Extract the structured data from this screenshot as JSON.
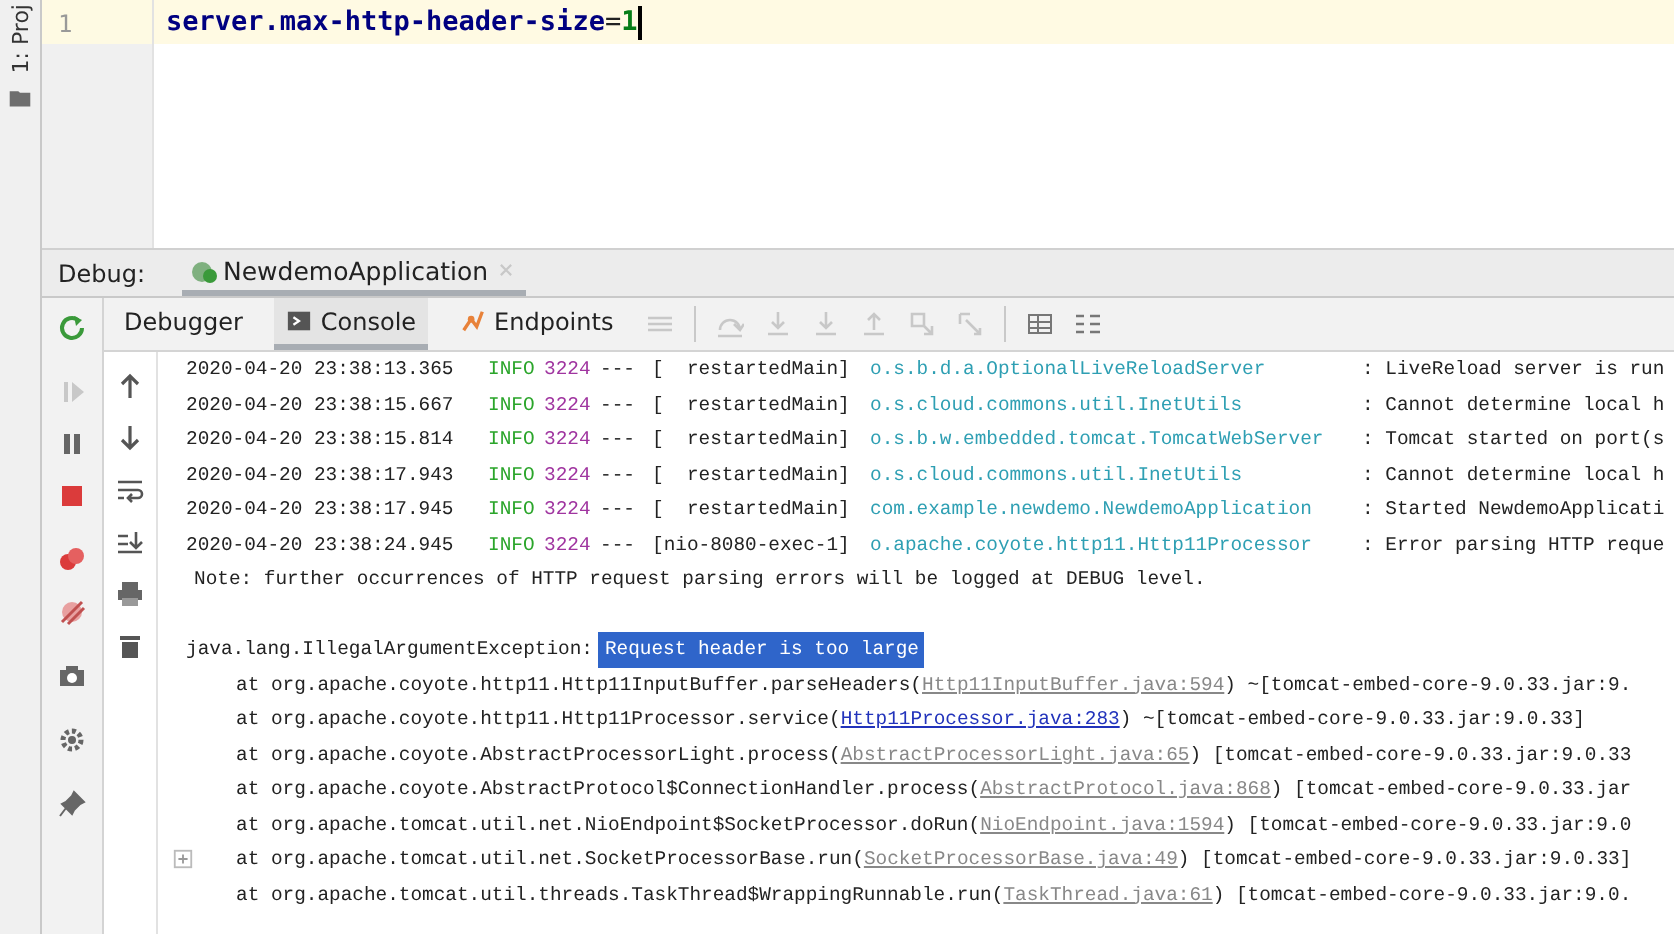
{
  "side_strip": {
    "label": "1: Proj"
  },
  "editor": {
    "lines": [
      {
        "number": "1",
        "key": "server.max-http-header-size",
        "separator": "=",
        "value": "1",
        "current": true
      }
    ]
  },
  "debug": {
    "label": "Debug:",
    "session_tab": {
      "title": "NewdemoApplication"
    }
  },
  "tabs": [
    {
      "label": "Debugger",
      "selected": false
    },
    {
      "label": "Console",
      "selected": true
    },
    {
      "label": "Endpoints",
      "selected": false
    }
  ],
  "console": {
    "log_lines": [
      {
        "timestamp": "2020-04-20 23:38:13.365",
        "level": "INFO",
        "pid": "3224",
        "separator": "---",
        "thread": "[  restartedMain]",
        "logger": "o.s.b.d.a.OptionalLiveReloadServer",
        "message": ": LiveReload server is run"
      },
      {
        "timestamp": "2020-04-20 23:38:15.667",
        "level": "INFO",
        "pid": "3224",
        "separator": "---",
        "thread": "[  restartedMain]",
        "logger": "o.s.cloud.commons.util.InetUtils",
        "message": ": Cannot determine local h"
      },
      {
        "timestamp": "2020-04-20 23:38:15.814",
        "level": "INFO",
        "pid": "3224",
        "separator": "---",
        "thread": "[  restartedMain]",
        "logger": "o.s.b.w.embedded.tomcat.TomcatWebServer",
        "message": ": Tomcat started on port(s"
      },
      {
        "timestamp": "2020-04-20 23:38:17.943",
        "level": "INFO",
        "pid": "3224",
        "separator": "---",
        "thread": "[  restartedMain]",
        "logger": "o.s.cloud.commons.util.InetUtils",
        "message": ": Cannot determine local h"
      },
      {
        "timestamp": "2020-04-20 23:38:17.945",
        "level": "INFO",
        "pid": "3224",
        "separator": "---",
        "thread": "[  restartedMain]",
        "logger": "com.example.newdemo.NewdemoApplication",
        "message": ": Started NewdemoApplicati"
      },
      {
        "timestamp": "2020-04-20 23:38:24.945",
        "level": "INFO",
        "pid": "3224",
        "separator": "---",
        "thread": "[nio-8080-exec-1]",
        "logger": "o.apache.coyote.http11.Http11Processor",
        "message": ": Error parsing HTTP reque"
      }
    ],
    "note": "Note: further occurrences of HTTP request parsing errors will be logged at DEBUG level.",
    "exception": {
      "type": "java.lang.IllegalArgumentException:",
      "selected_text": "Request header is too large"
    },
    "frames": [
      {
        "call": "at org.apache.coyote.http11.Http11InputBuffer.parseHeaders(",
        "link": "Http11InputBuffer.java:594",
        "suffix": ") ~[tomcat-embed-core-9.0.33.jar:9.",
        "highlighted": false,
        "fold_marker": false
      },
      {
        "call": "at org.apache.coyote.http11.Http11Processor.service(",
        "link": "Http11Processor.java:283",
        "suffix": ") ~[tomcat-embed-core-9.0.33.jar:9.0.33]",
        "highlighted": true,
        "fold_marker": false
      },
      {
        "call": "at org.apache.coyote.AbstractProcessorLight.process(",
        "link": "AbstractProcessorLight.java:65",
        "suffix": ") [tomcat-embed-core-9.0.33.jar:9.0.33",
        "highlighted": false,
        "fold_marker": false
      },
      {
        "call": "at org.apache.coyote.AbstractProtocol$ConnectionHandler.process(",
        "link": "AbstractProtocol.java:868",
        "suffix": ") [tomcat-embed-core-9.0.33.jar",
        "highlighted": false,
        "fold_marker": false
      },
      {
        "call": "at org.apache.tomcat.util.net.NioEndpoint$SocketProcessor.doRun(",
        "link": "NioEndpoint.java:1594",
        "suffix": ") [tomcat-embed-core-9.0.33.jar:9.0",
        "highlighted": false,
        "fold_marker": false
      },
      {
        "call": "at org.apache.tomcat.util.net.SocketProcessorBase.run(",
        "link": "SocketProcessorBase.java:49",
        "suffix": ") [tomcat-embed-core-9.0.33.jar:9.0.33]",
        "highlighted": false,
        "fold_marker": true
      },
      {
        "call": "at org.apache.tomcat.util.threads.TaskThread$WrappingRunnable.run(",
        "link": "TaskThread.java:61",
        "suffix": ") [tomcat-embed-core-9.0.33.jar:9.0.",
        "highlighted": false,
        "fold_marker": false
      }
    ]
  }
}
